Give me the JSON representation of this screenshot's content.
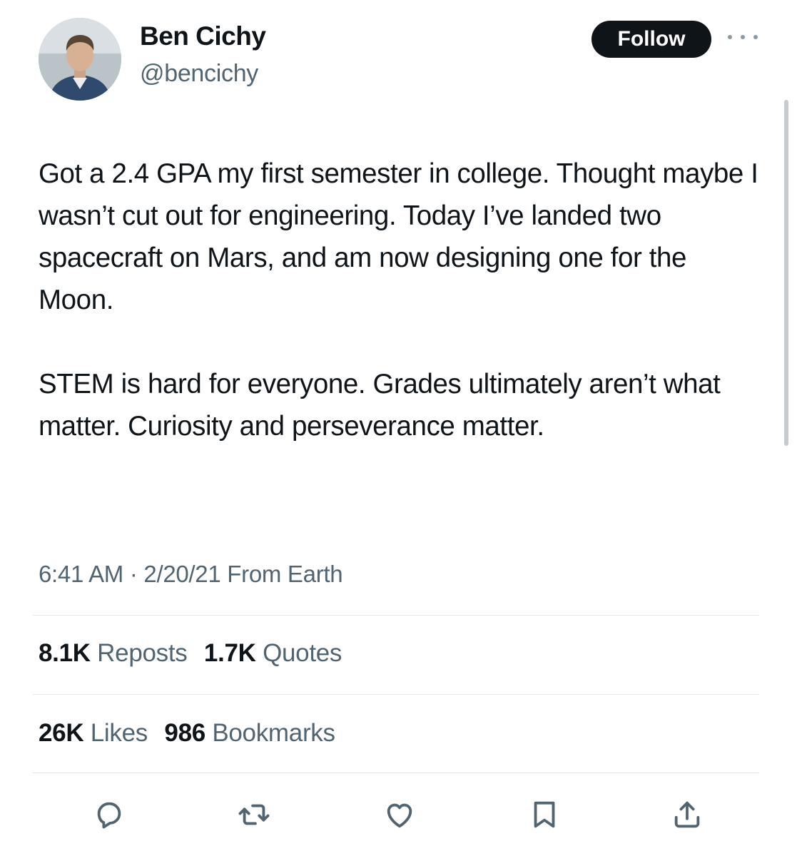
{
  "author": {
    "display_name": "Ben Cichy",
    "handle": "@bencichy"
  },
  "header": {
    "follow_label": "Follow",
    "more_icon": "ellipsis-icon"
  },
  "tweet": {
    "paragraphs": [
      "Got a 2.4 GPA my first semester in college. Thought maybe I wasn’t cut out for engineering. Today I’ve landed two spacecraft on Mars, and am now designing one for the Moon.",
      "STEM is hard for everyone. Grades ultimately aren’t what matter.  Curiosity and perseverance matter."
    ],
    "timestamp": "6:41 AM · 2/20/21 From Earth"
  },
  "stats": {
    "reposts_count": "8.1K",
    "reposts_label": "Reposts",
    "quotes_count": "1.7K",
    "quotes_label": "Quotes",
    "likes_count": "26K",
    "likes_label": "Likes",
    "bookmarks_count": "986",
    "bookmarks_label": "Bookmarks"
  },
  "actions": [
    "reply-icon",
    "repost-icon",
    "like-icon",
    "bookmark-icon",
    "share-icon"
  ],
  "colors": {
    "text": "#0f1419",
    "secondary_text": "#536471",
    "follow_button_bg": "#0f1419",
    "divider": "#e3e6e8"
  }
}
